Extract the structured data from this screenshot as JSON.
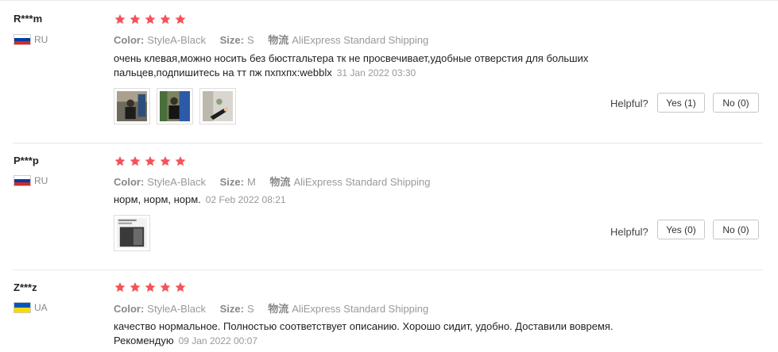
{
  "reviews": [
    {
      "user": "R***m",
      "country": "RU",
      "rating": 5,
      "color_label": "Color:",
      "color": "StyleA-Black",
      "size_label": "Size:",
      "size": "S",
      "ship_label": "物流",
      "shipping": "AliExpress Standard Shipping",
      "text": "очень клевая,можно носить без бюстгальтера тк не просвечивает,удобные отверстия для больших пальцев,подпишитесь на тт пж пхпхпх:webblx",
      "date": "31 Jan 2022 03:30",
      "photo_count": 3,
      "helpful_label": "Helpful?",
      "yes_label": "Yes (1)",
      "no_label": "No (0)"
    },
    {
      "user": "P***p",
      "country": "RU",
      "rating": 5,
      "color_label": "Color:",
      "color": "StyleA-Black",
      "size_label": "Size:",
      "size": "M",
      "ship_label": "物流",
      "shipping": "AliExpress Standard Shipping",
      "text": "норм, норм, норм.",
      "date": "02 Feb 2022 08:21",
      "photo_count": 1,
      "helpful_label": "Helpful?",
      "yes_label": "Yes (0)",
      "no_label": "No (0)"
    },
    {
      "user": "Z***z",
      "country": "UA",
      "rating": 5,
      "color_label": "Color:",
      "color": "StyleA-Black",
      "size_label": "Size:",
      "size": "S",
      "ship_label": "物流",
      "shipping": "AliExpress Standard Shipping",
      "text": "качество нормальное. Полностью соответствует описанию. Хорошо сидит, удобно. Доставили вовремя. Рекомендую",
      "date": "09 Jan 2022 00:07"
    }
  ],
  "colors": {
    "star": "#f5535a",
    "ru_white": "#ffffff",
    "ru_blue": "#0039a6",
    "ru_red": "#d52b1e",
    "ua_blue": "#0057b7",
    "ua_yellow": "#ffd700"
  }
}
